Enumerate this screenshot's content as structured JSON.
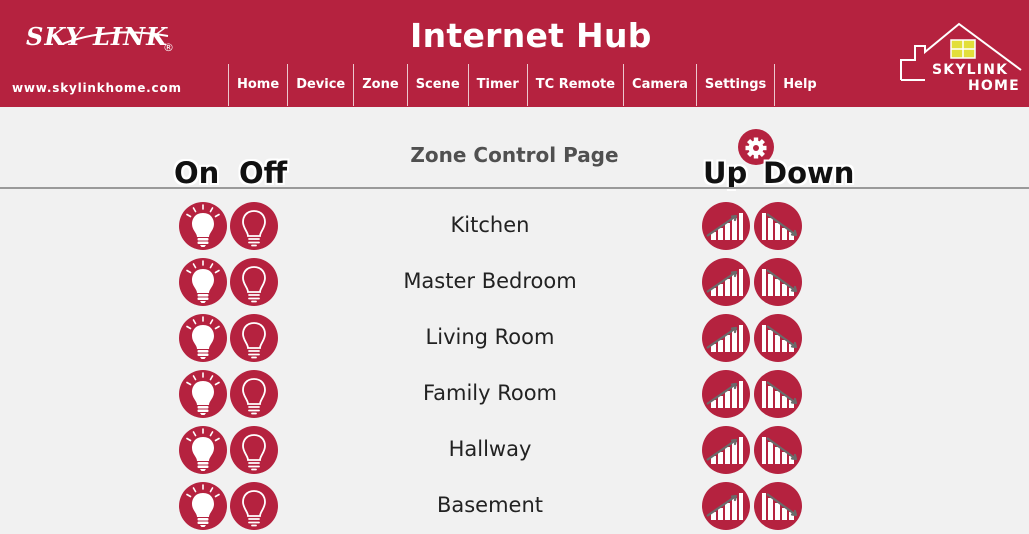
{
  "header": {
    "logo_text": "SKY LINK",
    "logo_reg": "®",
    "url": "www.skylinkhome.com",
    "title": "Internet Hub",
    "brand_line1": "SKYLINK",
    "brand_line2": "HOME",
    "nav": [
      "Home",
      "Device",
      "Zone",
      "Scene",
      "Timer",
      "TC Remote",
      "Camera",
      "Settings",
      "Help"
    ]
  },
  "page": {
    "title": "Zone Control Page",
    "on_label": "On",
    "off_label": "Off",
    "up_label": "Up",
    "down_label": "Down"
  },
  "zones": [
    "Kitchen",
    "Master Bedroom",
    "Living Room",
    "Family Room",
    "Hallway",
    "Basement"
  ],
  "icons": {
    "settings": "gear-icon",
    "on": "light-bulb-on-icon",
    "off": "light-bulb-off-icon",
    "up": "dim-up-icon",
    "down": "dim-down-icon"
  },
  "colors": {
    "brand": "#b5223f",
    "background": "#f1f1f1"
  }
}
